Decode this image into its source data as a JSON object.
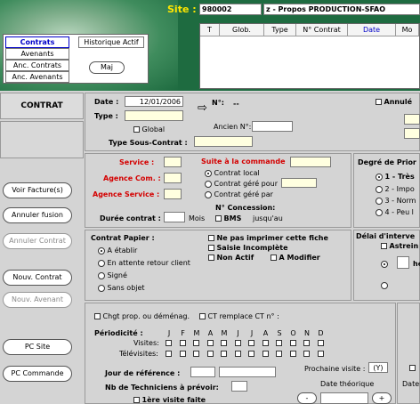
{
  "header": {
    "site_label": "Site :",
    "site_code": "980002",
    "site_name": "z - Propos PRODUCTION-SFAO"
  },
  "nav": {
    "tabs": [
      "Contrats",
      "Avenants",
      "Anc. Contrats",
      "Anc. Avenants"
    ],
    "history_tab": "Historique Actif",
    "maj_button": "Maj"
  },
  "grid": {
    "columns": [
      "T",
      "Glob.",
      "Type",
      "N° Contrat",
      "Date",
      "Mo"
    ]
  },
  "section_title": "CONTRAT",
  "left_buttons": [
    {
      "label": "Voir Facture(s)",
      "enabled": true
    },
    {
      "label": "Annuler fusion",
      "enabled": true
    },
    {
      "label": "Annuler Contrat",
      "enabled": false
    },
    {
      "label": "Nouv. Contrat",
      "enabled": true
    },
    {
      "label": "Nouv. Avenant",
      "enabled": false
    },
    {
      "label": "PC Site",
      "enabled": true
    },
    {
      "label": "PC Commande",
      "enabled": true
    }
  ],
  "contrat": {
    "date_label": "Date :",
    "date_value": "12/01/2006",
    "type_label": "Type :",
    "num_label": "N°:",
    "num_value": "--",
    "annule_label": "Annulé",
    "global_label": "Global",
    "ancien_label": "Ancien N°:",
    "sous_contrat_label": "Type Sous-Contrat :"
  },
  "service": {
    "service_label": "Service :",
    "agence_com_label": "Agence Com. :",
    "agence_service_label": "Agence Service :",
    "duree_label": "Durée contrat :",
    "mois_label": "Mois",
    "suite_label": "Suite à la commande",
    "options": [
      "Contrat local",
      "Contrat géré pour",
      "Contrat géré par"
    ],
    "concession_label": "N° Concession:",
    "bms_label": "BMS",
    "jusquau_label": "jusqu'au"
  },
  "priority": {
    "title": "Degré de Prior",
    "options": [
      "1 - Très",
      "2 - Impo",
      "3 - Norm",
      "4 - Peu l"
    ]
  },
  "papier": {
    "title": "Contrat Papier :",
    "options": [
      "A établir",
      "En attente retour client",
      "Signé",
      "Sans objet"
    ],
    "no_print_label": "Ne pas imprimer cette fiche",
    "saisie_label": "Saisie Incomplète",
    "non_actif_label": "Non Actif",
    "a_modifier_label": "A Modifier"
  },
  "delai": {
    "title": "Délai d'interve",
    "astreinte_label": "Astrein",
    "he_label": "he"
  },
  "periodicite": {
    "chgt_label": "Chgt prop. ou déménag.",
    "ct_remplace_label": "CT remplace CT n° :",
    "title": "Périodicité :",
    "months": [
      "J",
      "F",
      "M",
      "A",
      "M",
      "J",
      "J",
      "A",
      "S",
      "O",
      "N",
      "D"
    ],
    "visites_label": "Visites:",
    "televisites_label": "Télévisites:",
    "jour_ref_label": "Jour de référence :",
    "nb_tech_label": "Nb de Techniciens à prévoir:",
    "premiere_visite_label": "1ère visite faite",
    "prochaine_label": "Prochaine visite :",
    "prochaine_value": "(Y)",
    "date_theorique_label": "Date théorique",
    "date_r_label": "Date r"
  }
}
